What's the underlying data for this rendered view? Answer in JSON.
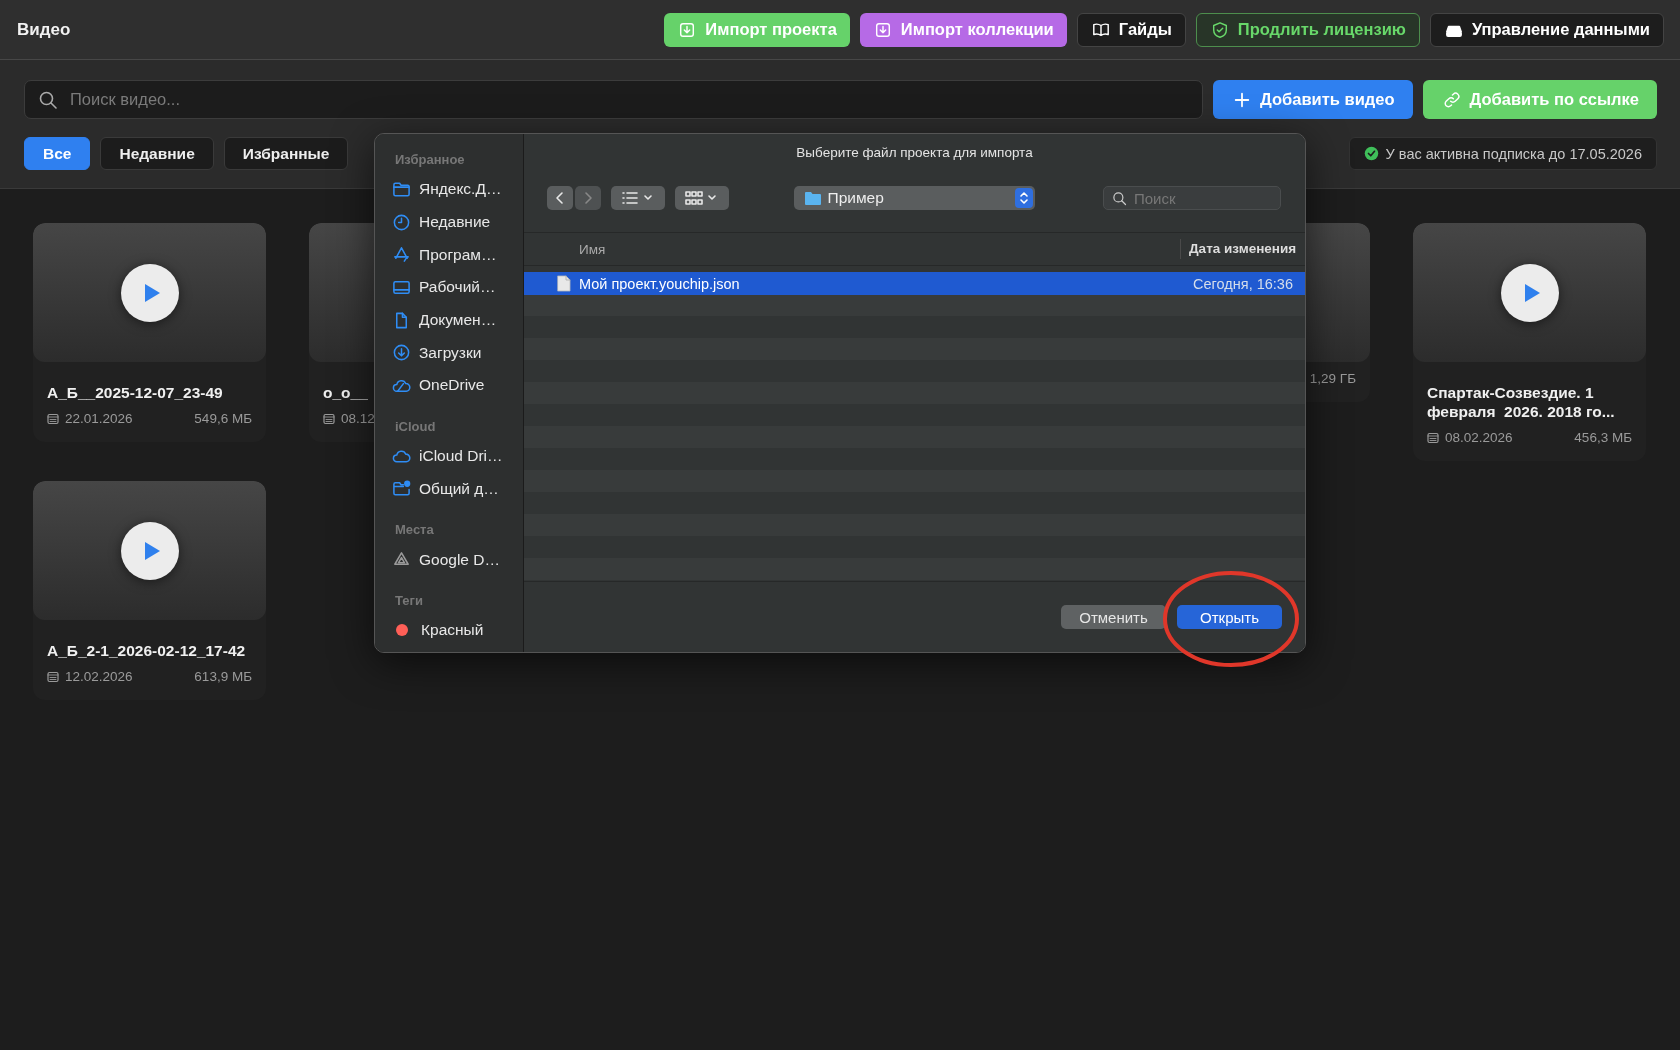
{
  "app": {
    "title": "Видео"
  },
  "header_buttons": [
    {
      "label": "Импорт проекта",
      "kind": "green"
    },
    {
      "label": "Импорт коллекции",
      "kind": "purple"
    },
    {
      "label": "Гайды",
      "kind": "dark"
    },
    {
      "label": "Продлить лицензию",
      "kind": "outline"
    },
    {
      "label": "Управление данными",
      "kind": "dark"
    }
  ],
  "search": {
    "placeholder": "Поиск видео..."
  },
  "action_buttons": [
    {
      "label": "Добавить видео",
      "kind": "blue"
    },
    {
      "label": "Добавить по ссылке",
      "kind": "green"
    }
  ],
  "filters": [
    {
      "label": "Все",
      "selected": true
    },
    {
      "label": "Недавние",
      "selected": false
    },
    {
      "label": "Избранные",
      "selected": false
    }
  ],
  "subscription": {
    "text": "У вас активна подписка до 17.05.2026"
  },
  "videos": [
    {
      "title": "А_Б__2025-12-07_23-49",
      "date": "22.01.2026",
      "size": "549,6 МБ"
    },
    {
      "title": "о_о__",
      "date": "08.12"
    },
    {
      "size": "1,29 ГБ"
    },
    {
      "title": "Спартак-Созвездие. 1 февраля  2026. 2018 го...",
      "date": "08.02.2026",
      "size": "456,3 МБ"
    },
    {
      "title": "А_Б_2-1_2026-02-12_17-42",
      "date": "12.02.2026",
      "size": "613,9 МБ"
    }
  ],
  "dialog": {
    "title": "Выберите файл проекта для импорта",
    "location": "Пример",
    "search_placeholder": "Поиск",
    "sidebar": [
      {
        "heading": "Избранное",
        "items": [
          {
            "label": "Яндекс.Д…"
          },
          {
            "label": "Недавние"
          },
          {
            "label": "Програм…"
          },
          {
            "label": "Рабочий…"
          },
          {
            "label": "Докумен…"
          },
          {
            "label": "Загрузки"
          },
          {
            "label": "OneDrive"
          }
        ]
      },
      {
        "heading": "iCloud",
        "items": [
          {
            "label": "iCloud Dri…"
          },
          {
            "label": "Общий д…"
          }
        ]
      },
      {
        "heading": "Места",
        "items": [
          {
            "label": "Google D…"
          }
        ]
      },
      {
        "heading": "Теги",
        "items": [
          {
            "label": "Красный",
            "color": "#ff5f57"
          }
        ]
      }
    ],
    "columns": [
      "Имя",
      "Дата изменения"
    ],
    "files": [
      {
        "name": "Мой проект.youchip.json",
        "modified": "Сегодня, 16:36",
        "selected": true
      }
    ],
    "buttons": [
      {
        "label": "Отменить",
        "kind": "secondary"
      },
      {
        "label": "Открыть",
        "kind": "primary"
      }
    ]
  }
}
